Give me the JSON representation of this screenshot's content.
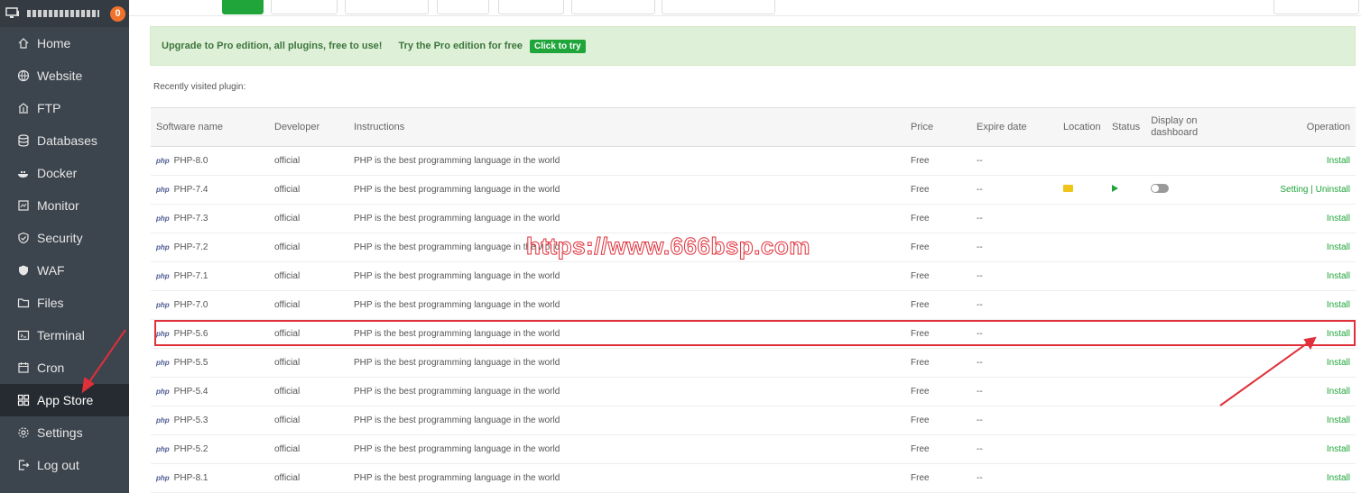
{
  "sidebar": {
    "server_badge": "0",
    "items": [
      {
        "label": "Home",
        "icon": "home-icon"
      },
      {
        "label": "Website",
        "icon": "globe-icon"
      },
      {
        "label": "FTP",
        "icon": "ftp-icon"
      },
      {
        "label": "Databases",
        "icon": "database-icon"
      },
      {
        "label": "Docker",
        "icon": "docker-icon"
      },
      {
        "label": "Monitor",
        "icon": "monitor-icon"
      },
      {
        "label": "Security",
        "icon": "shield-icon"
      },
      {
        "label": "WAF",
        "icon": "waf-shield-icon"
      },
      {
        "label": "Files",
        "icon": "folder-icon"
      },
      {
        "label": "Terminal",
        "icon": "terminal-icon"
      },
      {
        "label": "Cron",
        "icon": "calendar-icon"
      },
      {
        "label": "App Store",
        "icon": "grid-icon"
      },
      {
        "label": "Settings",
        "icon": "gear-icon"
      },
      {
        "label": "Log out",
        "icon": "logout-icon"
      }
    ]
  },
  "promo": {
    "text": "Upgrade to Pro edition, all plugins, free to use!",
    "try_text": "Try the Pro edition for free",
    "button": "Click to try"
  },
  "recent_label": "Recently visited plugin:",
  "table": {
    "headers": {
      "name": "Software name",
      "developer": "Developer",
      "instructions": "Instructions",
      "price": "Price",
      "expire": "Expire date",
      "location": "Location",
      "status": "Status",
      "dashboard": "Display on dashboard",
      "operation": "Operation"
    },
    "rows": [
      {
        "name": "PHP-8.0",
        "developer": "official",
        "instructions": "PHP is the best programming language in the world",
        "price": "Free",
        "expire": "--",
        "operation": "Install"
      },
      {
        "name": "PHP-7.4",
        "developer": "official",
        "instructions": "PHP is the best programming language in the world",
        "price": "Free",
        "expire": "--",
        "operation": "Setting | Uninstall",
        "installed": true
      },
      {
        "name": "PHP-7.3",
        "developer": "official",
        "instructions": "PHP is the best programming language in the world",
        "price": "Free",
        "expire": "--",
        "operation": "Install"
      },
      {
        "name": "PHP-7.2",
        "developer": "official",
        "instructions": "PHP is the best programming language in the world",
        "price": "Free",
        "expire": "--",
        "operation": "Install"
      },
      {
        "name": "PHP-7.1",
        "developer": "official",
        "instructions": "PHP is the best programming language in the world",
        "price": "Free",
        "expire": "--",
        "operation": "Install"
      },
      {
        "name": "PHP-7.0",
        "developer": "official",
        "instructions": "PHP is the best programming language in the world",
        "price": "Free",
        "expire": "--",
        "operation": "Install"
      },
      {
        "name": "PHP-5.6",
        "developer": "official",
        "instructions": "PHP is the best programming language in the world",
        "price": "Free",
        "expire": "--",
        "operation": "Install"
      },
      {
        "name": "PHP-5.5",
        "developer": "official",
        "instructions": "PHP is the best programming language in the world",
        "price": "Free",
        "expire": "--",
        "operation": "Install"
      },
      {
        "name": "PHP-5.4",
        "developer": "official",
        "instructions": "PHP is the best programming language in the world",
        "price": "Free",
        "expire": "--",
        "operation": "Install"
      },
      {
        "name": "PHP-5.3",
        "developer": "official",
        "instructions": "PHP is the best programming language in the world",
        "price": "Free",
        "expire": "--",
        "operation": "Install"
      },
      {
        "name": "PHP-5.2",
        "developer": "official",
        "instructions": "PHP is the best programming language in the world",
        "price": "Free",
        "expire": "--",
        "operation": "Install"
      },
      {
        "name": "PHP-8.1",
        "developer": "official",
        "instructions": "PHP is the best programming language in the world",
        "price": "Free",
        "expire": "--",
        "operation": "Install"
      }
    ],
    "php_logo": "php"
  },
  "watermark": "https://www.666bsp.com",
  "colors": {
    "accent": "#20a53a",
    "sidebar": "#3c444d",
    "annotation": "#e0303a"
  }
}
